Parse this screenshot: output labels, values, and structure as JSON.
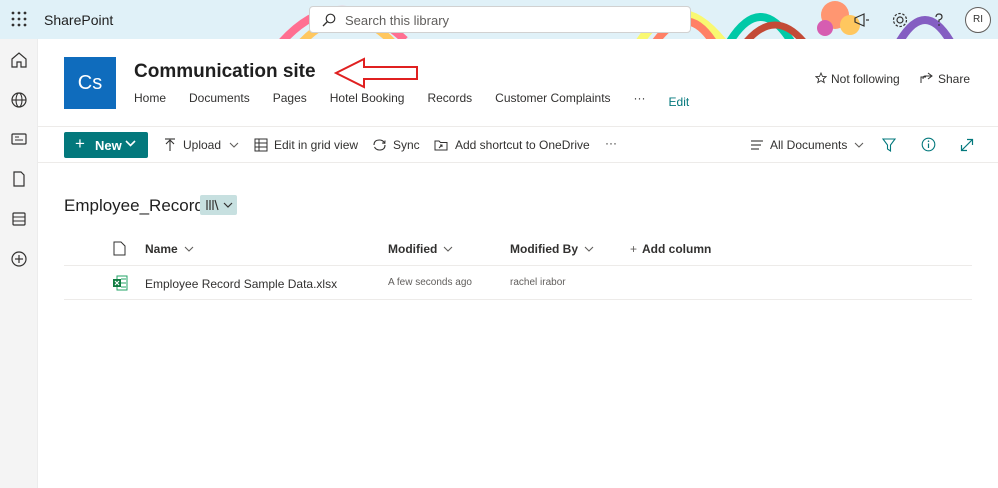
{
  "topbar": {
    "app_name": "SharePoint",
    "search_placeholder": "Search this library",
    "avatar_initials": "RI"
  },
  "site": {
    "logo_text": "Cs",
    "title": "Communication site",
    "nav": [
      "Home",
      "Documents",
      "Pages",
      "Hotel Booking",
      "Records",
      "Customer Complaints"
    ],
    "nav_more": "···",
    "nav_edit": "Edit",
    "follow_label": "Not following",
    "share_label": "Share"
  },
  "commandbar": {
    "new_label": "New",
    "upload_label": "Upload",
    "grid_label": "Edit in grid view",
    "sync_label": "Sync",
    "shortcut_label": "Add shortcut to OneDrive",
    "more": "···",
    "view_label": "All Documents"
  },
  "library": {
    "title": "Employee_Record",
    "columns": {
      "name": "Name",
      "modified": "Modified",
      "modified_by": "Modified By",
      "add_column": "Add column"
    },
    "rows": [
      {
        "name": "Employee Record Sample Data.xlsx",
        "modified": "A few seconds ago",
        "modified_by": "rachel irabor"
      }
    ]
  },
  "colors": {
    "accent": "#03787c",
    "site_logo": "#0f6cbd",
    "annotation_arrow": "#e02020"
  }
}
